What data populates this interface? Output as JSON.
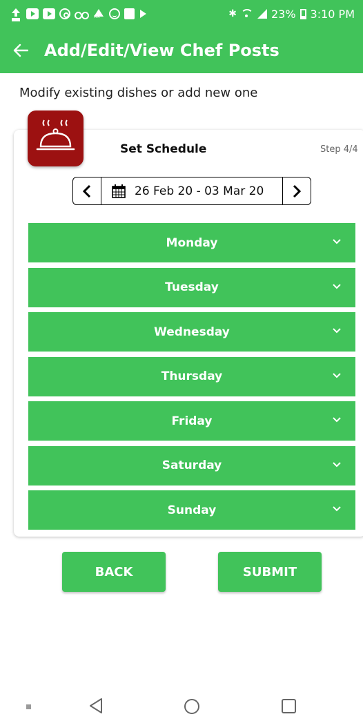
{
  "status_bar": {
    "battery": "23%",
    "time": "3:10 PM"
  },
  "app_bar": {
    "title": "Add/Edit/View Chef Posts"
  },
  "subtitle": "Modify existing dishes or add new one",
  "card": {
    "title": "Set Schedule",
    "step": "Step 4/4",
    "date_range": "26 Feb 20 - 03 Mar 20"
  },
  "days": [
    "Monday",
    "Tuesday",
    "Wednesday",
    "Thursday",
    "Friday",
    "Saturday",
    "Sunday"
  ],
  "buttons": {
    "back": "BACK",
    "submit": "SUBMIT"
  },
  "colors": {
    "primary": "#41c35a",
    "chef_icon_bg": "#9c1111"
  }
}
